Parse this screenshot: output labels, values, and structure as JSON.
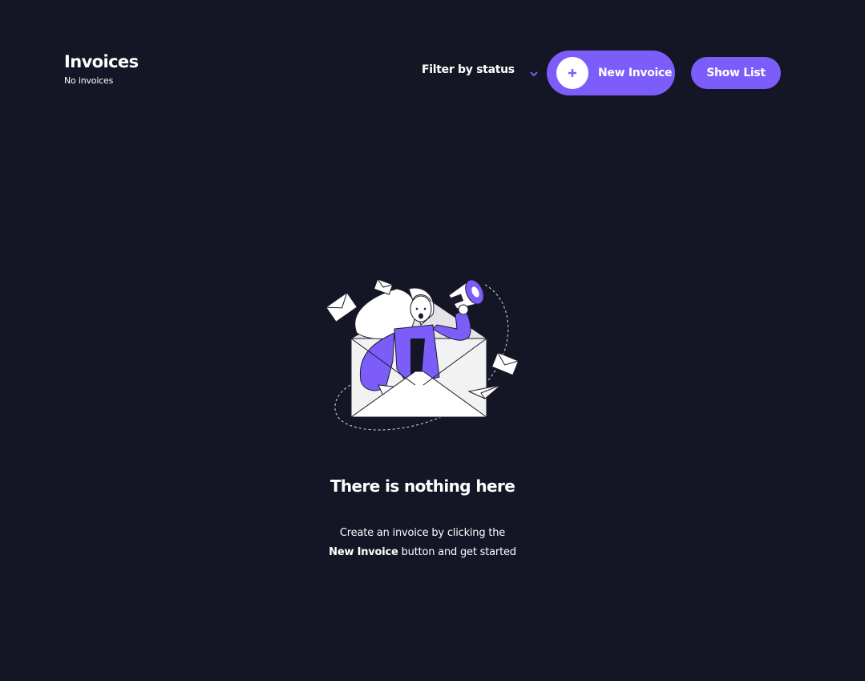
{
  "header": {
    "title": "Invoices",
    "subtitle": "No invoices"
  },
  "filter": {
    "label": "Filter by status",
    "icon": "chevron-down-icon"
  },
  "actions": {
    "new_invoice_label": "New Invoice",
    "new_invoice_icon": "plus-icon",
    "show_list_label": "Show List"
  },
  "empty_state": {
    "illustration": "woman-with-megaphone-in-envelope",
    "title": "There is nothing here",
    "line1": "Create an invoice by clicking the",
    "line2_bold": "New Invoice",
    "line2_rest": " button and get started"
  },
  "colors": {
    "background": "#141625",
    "accent": "#7C5DFA",
    "text": "#FFFFFF"
  }
}
